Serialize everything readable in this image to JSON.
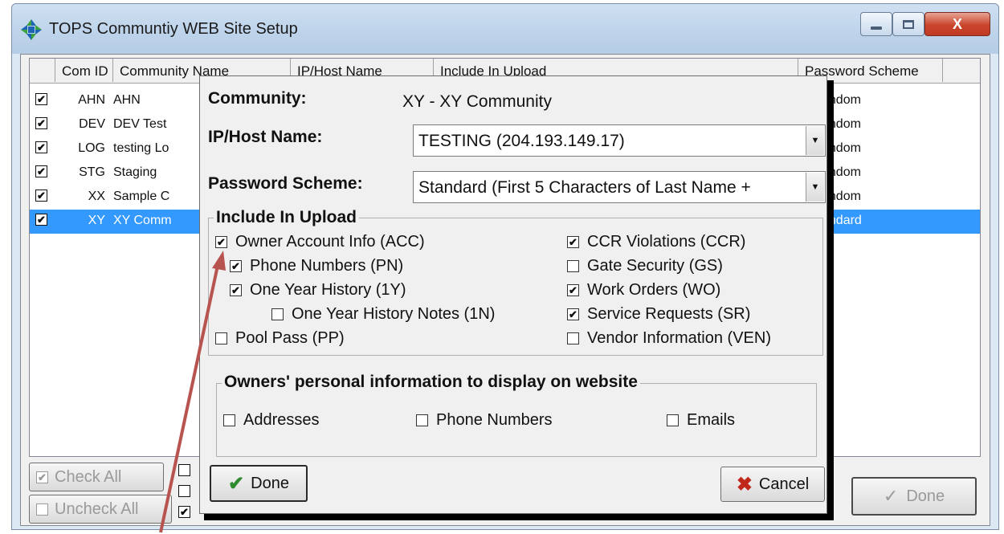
{
  "window": {
    "title": "TOPS Communtiy WEB Site Setup",
    "controls": {
      "minimize": "minimize",
      "maximize": "maximize",
      "close": "X"
    }
  },
  "list": {
    "headers": [
      "Com ID",
      "Community Name",
      "IP/Host Name",
      "Include In Upload",
      "Password Scheme"
    ],
    "rows": [
      {
        "checked": true,
        "id": "AHN",
        "name": "AHN",
        "password": "andom"
      },
      {
        "checked": true,
        "id": "DEV",
        "name": "DEV Test",
        "password": "andom"
      },
      {
        "checked": true,
        "id": "LOG",
        "name": "testing Lo",
        "password": "andom"
      },
      {
        "checked": true,
        "id": "STG",
        "name": "Staging",
        "password": "andom"
      },
      {
        "checked": true,
        "id": "XX",
        "name": "Sample C",
        "password": "andom"
      },
      {
        "checked": true,
        "id": "XY",
        "name": "XY Comm",
        "password": "andard",
        "selected": true
      }
    ]
  },
  "main_buttons": {
    "check_all": "Check All",
    "uncheck_all": "Uncheck All",
    "done": "Done"
  },
  "dialog": {
    "community_label": "Community:",
    "community_value": "XY - XY Community",
    "host_label": "IP/Host Name:",
    "host_value": "TESTING (204.193.149.17)",
    "pw_label": "Password Scheme:",
    "pw_value": "Standard (First 5 Characters of Last Name +",
    "upload_group": "Include In Upload",
    "left_options": [
      {
        "label": "Owner Account Info (ACC)",
        "checked": true
      },
      {
        "label": "Phone Numbers (PN)",
        "checked": true
      },
      {
        "label": "One Year History (1Y)",
        "checked": true
      },
      {
        "label": "One Year History Notes (1N)",
        "checked": false
      },
      {
        "label": "Pool Pass (PP)",
        "checked": false
      }
    ],
    "right_options": [
      {
        "label": "CCR Violations (CCR)",
        "checked": true
      },
      {
        "label": "Gate Security (GS)",
        "checked": false
      },
      {
        "label": "Work Orders (WO)",
        "checked": true
      },
      {
        "label": "Service Requests (SR)",
        "checked": true
      },
      {
        "label": "Vendor Information (VEN)",
        "checked": false
      }
    ],
    "personal_group": "Owners' personal information to display on website",
    "personal_options": [
      {
        "label": "Addresses",
        "checked": false
      },
      {
        "label": "Phone Numbers",
        "checked": false
      },
      {
        "label": "Emails",
        "checked": false
      }
    ],
    "done_label": "Done",
    "cancel_label": "Cancel"
  },
  "colors": {
    "selection": "#3399ff",
    "arrow": "#b85450",
    "done_check": "#2e8b2e",
    "cancel_x": "#c0281c"
  }
}
